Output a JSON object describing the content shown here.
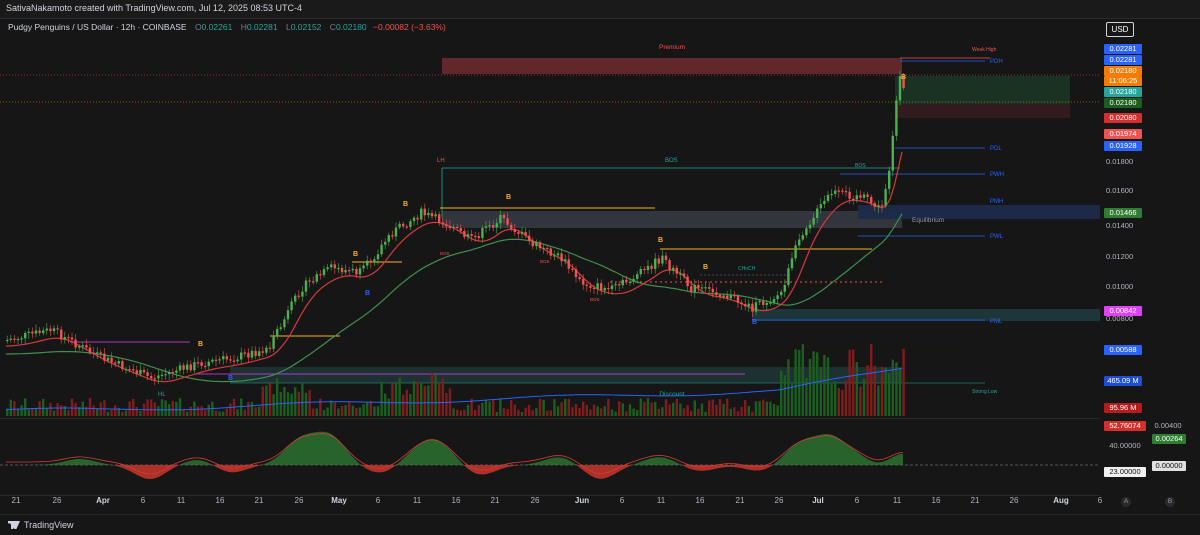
{
  "attribution": "SativaNakamoto created with TradingView.com, Jul 12, 2025 08:53 UTC-4",
  "symbol": {
    "title": "Pudgy Penguins / US Dollar · 12h · COINBASE",
    "o_label": "O",
    "o": "0.02261",
    "h_label": "H",
    "h": "0.02281",
    "l_label": "L",
    "l": "0.02152",
    "c_label": "C",
    "c": "0.02180",
    "change": "−0.00082 (−3.63%)"
  },
  "currency": "USD",
  "price_tags": {
    "pdh1": "0.02281",
    "pdh2": "0.02281",
    "last": "0.02180",
    "countdown": "11:06:25",
    "close1": "0.02180",
    "close2": "0.02180",
    "red1": "0.02080",
    "red2": "0.01974",
    "pdl": "0.01928",
    "eq": "0.01466",
    "magenta": "0.00842",
    "blue": "0.00588",
    "volume": "465.09 M",
    "vol2": "95.96 M"
  },
  "price_ticks": [
    "0.01800",
    "0.01600",
    "0.01400",
    "0.01200",
    "0.01000",
    "0.00800"
  ],
  "oscillator": {
    "tag_red": "52.76074",
    "right_top": "0.00400",
    "tag_green": "0.00264",
    "mid": "40.00000",
    "low": "23.00000",
    "zero": "0.00000"
  },
  "labels": {
    "premium": "Premium",
    "discount": "Discount",
    "equilibrium": "Equilibrium",
    "weak_high": "Weak High",
    "strong_low": "Strong Low",
    "pdh": "PDH",
    "pdl": "PDL",
    "pwh": "PWH",
    "pmh": "PMH",
    "pwl": "PWL",
    "pml": "PML",
    "lh": "LH",
    "bos": "BOS",
    "bos_small": "BOS",
    "hl": "HL",
    "choch": "CHoCH",
    "b": "B"
  },
  "time_axis": [
    "21",
    "26",
    "Apr",
    "6",
    "11",
    "16",
    "21",
    "26",
    "May",
    "6",
    "11",
    "16",
    "21",
    "26",
    "Jun",
    "6",
    "11",
    "16",
    "21",
    "26",
    "Jul",
    "6",
    "11",
    "16",
    "21",
    "26",
    "Aug",
    "6"
  ],
  "axis_buttons": [
    "A",
    "B"
  ],
  "footer": "TradingView",
  "colors": {
    "bull": "#26a69a",
    "bull_bright": "#4caf50",
    "bear": "#ef5350",
    "premium_zone": "#7a2a2e",
    "discount_zone": "#1f3b3a",
    "equilibrium_zone": "#3a3d45",
    "accent_blue": "#2962ff",
    "orange": "#f7931a"
  }
}
